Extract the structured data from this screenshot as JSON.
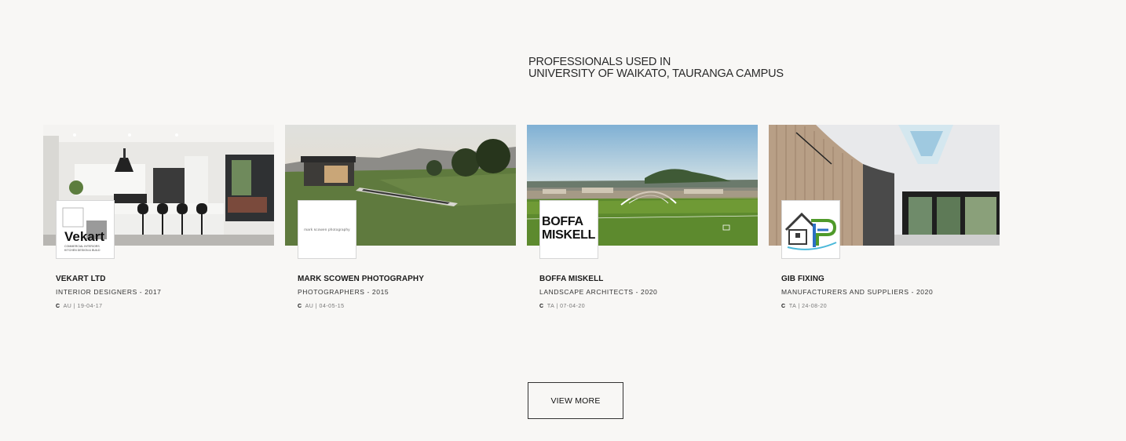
{
  "heading": {
    "line1": "PROFESSIONALS USED IN",
    "line2": "UNIVERSITY OF WAIKATO, TAURANGA CAMPUS"
  },
  "cards": [
    {
      "name": "VEKART LTD",
      "category": "INTERIOR DESIGNERS - 2017",
      "date_prefix": "C",
      "date": "AU | 19-04-17",
      "logo_text": "Vekart",
      "logo_sub": "COMMERCIAL INTERIORS · KITCHEN DESIGN & BUILD"
    },
    {
      "name": "MARK SCOWEN PHOTOGRAPHY",
      "category": "PHOTOGRAPHERS - 2015",
      "date_prefix": "C",
      "date": "AU | 04-05-15",
      "logo_text": "mark scowen photography"
    },
    {
      "name": "BOFFA MISKELL",
      "category": "LANDSCAPE ARCHITECTS - 2020",
      "date_prefix": "C",
      "date": "TA | 07-04-20",
      "logo_line1": "BOFFA",
      "logo_line2": "MISKELL"
    },
    {
      "name": "GIB FIXING",
      "category": "MANUFACTURERS AND SUPPLIERS - 2020",
      "date_prefix": "C",
      "date": "TA | 24-08-20",
      "logo_icon": "house-logo-icon"
    }
  ],
  "view_more": "VIEW MORE"
}
